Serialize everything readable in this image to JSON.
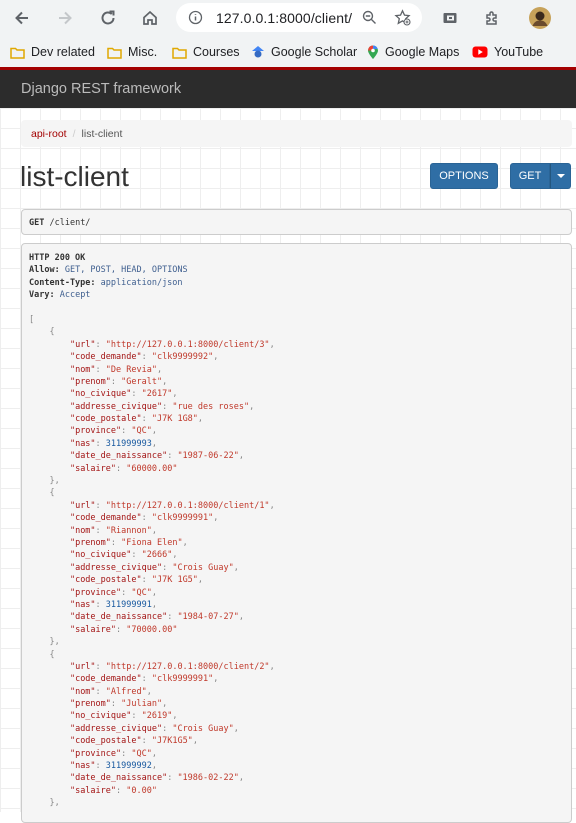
{
  "browser": {
    "url": "127.0.0.1:8000/client/",
    "bookmarks": [
      {
        "label": "Dev related",
        "icon": "folder-icon"
      },
      {
        "label": "Misc.",
        "icon": "folder-icon"
      },
      {
        "label": "Courses",
        "icon": "folder-icon"
      },
      {
        "label": "Google Scholar",
        "icon": "google-scholar-icon"
      },
      {
        "label": "Google Maps",
        "icon": "google-maps-icon"
      },
      {
        "label": "YouTube",
        "icon": "youtube-icon"
      }
    ]
  },
  "navbar": {
    "brand": "Django REST framework"
  },
  "breadcrumb": {
    "root": "api-root",
    "separator": "/",
    "current": "list-client"
  },
  "page": {
    "title": "list-client",
    "options_label": "OPTIONS",
    "get_label": "GET"
  },
  "request": {
    "method": "GET",
    "path": "/client/"
  },
  "response": {
    "status": "HTTP 200 OK",
    "headers": [
      {
        "name": "Allow:",
        "value": "GET, POST, HEAD, OPTIONS"
      },
      {
        "name": "Content-Type:",
        "value": "application/json"
      },
      {
        "name": "Vary:",
        "value": "Accept"
      }
    ],
    "clients": [
      {
        "url": "\"http://127.0.0.1:8000/client/3\"",
        "code_demande": "\"clk9999992\"",
        "nom": "\"De Revia\"",
        "prenom": "\"Geralt\"",
        "no_civique": "\"2617\"",
        "addresse_civique": "\"rue des roses\"",
        "code_postale": "\"J7K 1G8\"",
        "province": "\"QC\"",
        "nas": "311999993",
        "date_de_naissance": "\"1987-06-22\"",
        "salaire": "\"60000.00\""
      },
      {
        "url": "\"http://127.0.0.1:8000/client/1\"",
        "code_demande": "\"clk9999991\"",
        "nom": "\"Riannon\"",
        "prenom": "\"Fiona Elen\"",
        "no_civique": "\"2666\"",
        "addresse_civique": "\"Crois Guay\"",
        "code_postale": "\"J7K 1G5\"",
        "province": "\"QC\"",
        "nas": "311999991",
        "date_de_naissance": "\"1984-07-27\"",
        "salaire": "\"70000.00\""
      },
      {
        "url": "\"http://127.0.0.1:8000/client/2\"",
        "code_demande": "\"clk9999991\"",
        "nom": "\"Alfred\"",
        "prenom": "\"Julian\"",
        "no_civique": "\"2619\"",
        "addresse_civique": "\"Crois Guay\"",
        "code_postale": "\"J7K1G5\"",
        "province": "\"QC\"",
        "nas": "311999992",
        "date_de_naissance": "\"1986-02-22\"",
        "salaire": "\"0.00\""
      }
    ]
  },
  "colors": {
    "accent": "#a30000",
    "navbar": "#2c2c2c",
    "button": "#2f6ea5"
  }
}
